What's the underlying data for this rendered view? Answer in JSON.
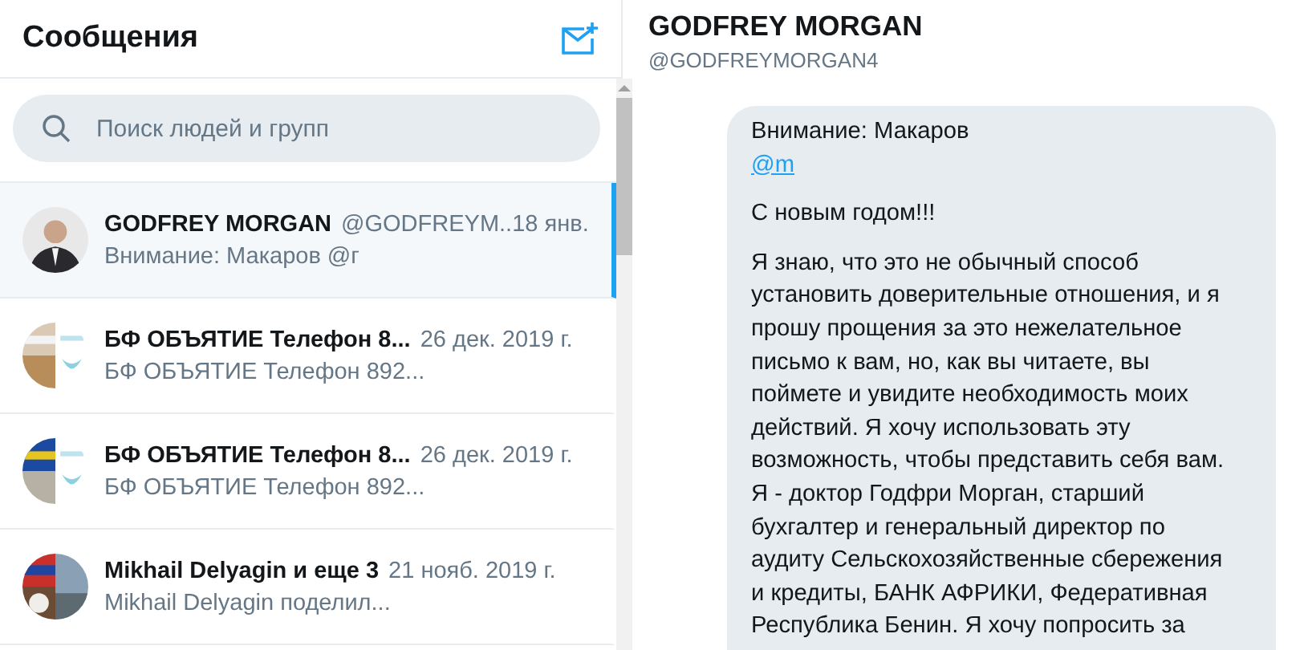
{
  "sidebar": {
    "title": "Сообщения",
    "search": {
      "placeholder": "Поиск людей и групп"
    },
    "conversations": [
      {
        "name": "GODFREY MORGAN",
        "handle": "@GODFREYM..",
        "date": "18 янв.",
        "preview": "Внимание: Макаров @г",
        "selected": true
      },
      {
        "name": "БФ ОБЪЯТИЕ Телефон 8...",
        "date": "26 дек. 2019 г.",
        "preview": "БФ ОБЪЯТИЕ Телефон 892...",
        "selected": false
      },
      {
        "name": "БФ ОБЪЯТИЕ Телефон 8...",
        "date": "26 дек. 2019 г.",
        "preview": "БФ ОБЪЯТИЕ Телефон 892...",
        "selected": false
      },
      {
        "name": "Mikhail Delyagin и еще 3",
        "date": "21 нояб. 2019 г.",
        "preview": "Mikhail Delyagin поделил...",
        "selected": false
      }
    ]
  },
  "conversation": {
    "title": "GODFREY MORGAN",
    "handle": "@GODFREYMORGAN4",
    "message": {
      "lines": [
        "Внимание: Макаров"
      ],
      "mention": "@m",
      "paragraphs": [
        "С новым годом!!!",
        "Я знаю, что это не обычный способ установить доверительные отношения, и я прошу прощения за это нежелательное письмо к вам, но, как вы читаете, вы поймете и увидите необходимость моих действий. Я хочу использовать эту возможность, чтобы представить себя вам. Я - доктор Годфри Морган, старший бухгалтер и генеральный директор по аудиту Сельскохозяйственные сбережения и кредиты, БАНК АФРИКИ, Федеративная Республика Бенин. Я хочу попросить за"
      ]
    }
  }
}
